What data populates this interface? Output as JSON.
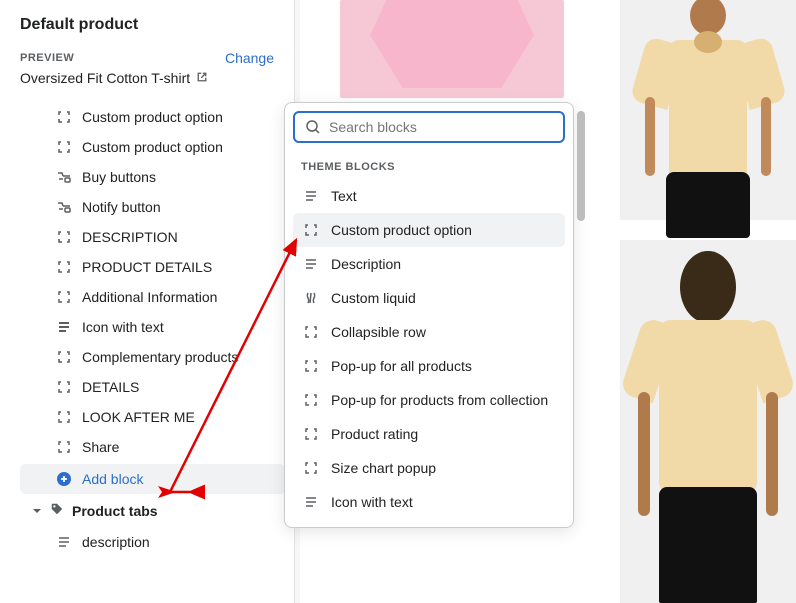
{
  "sidebar": {
    "title": "Default product",
    "preview_label": "PREVIEW",
    "change_label": "Change",
    "product_name": "Oversized Fit Cotton T-shirt",
    "blocks": [
      {
        "label": "Custom product option",
        "icon": "bracket"
      },
      {
        "label": "Custom product option",
        "icon": "bracket"
      },
      {
        "label": "Buy buttons",
        "icon": "buy"
      },
      {
        "label": "Notify button",
        "icon": "buy"
      },
      {
        "label": "DESCRIPTION",
        "icon": "bracket"
      },
      {
        "label": "PRODUCT DETAILS",
        "icon": "bracket"
      },
      {
        "label": "Additional Information",
        "icon": "bracket"
      },
      {
        "label": "Icon with text",
        "icon": "text"
      },
      {
        "label": "Complementary products",
        "icon": "bracket"
      },
      {
        "label": "DETAILS",
        "icon": "bracket"
      },
      {
        "label": "LOOK AFTER ME",
        "icon": "bracket"
      },
      {
        "label": "Share",
        "icon": "bracket"
      }
    ],
    "add_block": "Add block",
    "section": {
      "name": "Product tabs",
      "first_child": "description"
    }
  },
  "popover": {
    "search_placeholder": "Search blocks",
    "section_label": "THEME BLOCKS",
    "items": [
      {
        "label": "Text",
        "icon": "text"
      },
      {
        "label": "Custom product option",
        "icon": "bracket",
        "highlighted": true
      },
      {
        "label": "Description",
        "icon": "text"
      },
      {
        "label": "Custom liquid",
        "icon": "liquid"
      },
      {
        "label": "Collapsible row",
        "icon": "bracket"
      },
      {
        "label": "Pop-up for all products",
        "icon": "bracket"
      },
      {
        "label": "Pop-up for products from collection",
        "icon": "bracket"
      },
      {
        "label": "Product rating",
        "icon": "bracket"
      },
      {
        "label": "Size chart popup",
        "icon": "bracket"
      },
      {
        "label": "Icon with text",
        "icon": "text"
      }
    ]
  }
}
